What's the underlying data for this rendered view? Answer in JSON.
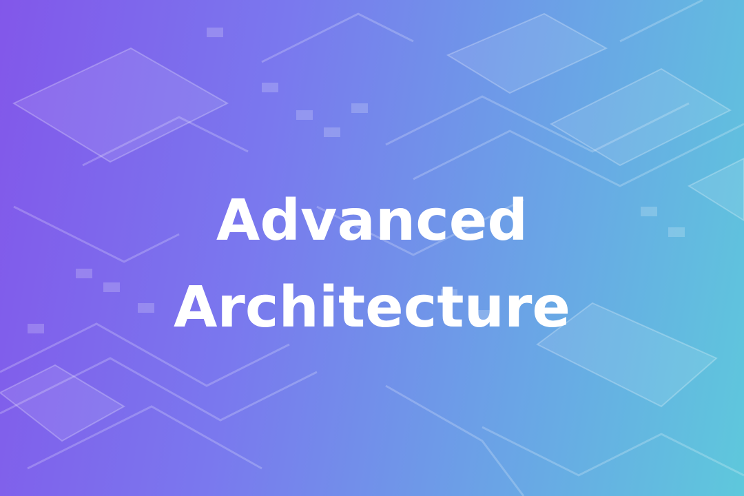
{
  "slide": {
    "title_line1": "Advanced",
    "title_line2": "Architecture"
  },
  "colors": {
    "gradient_start": "#8257ea",
    "gradient_mid": "#7a78ee",
    "gradient_end": "#5ec8dc",
    "title_text": "#ffffff"
  },
  "background": {
    "image": "circuit-board-photo"
  }
}
